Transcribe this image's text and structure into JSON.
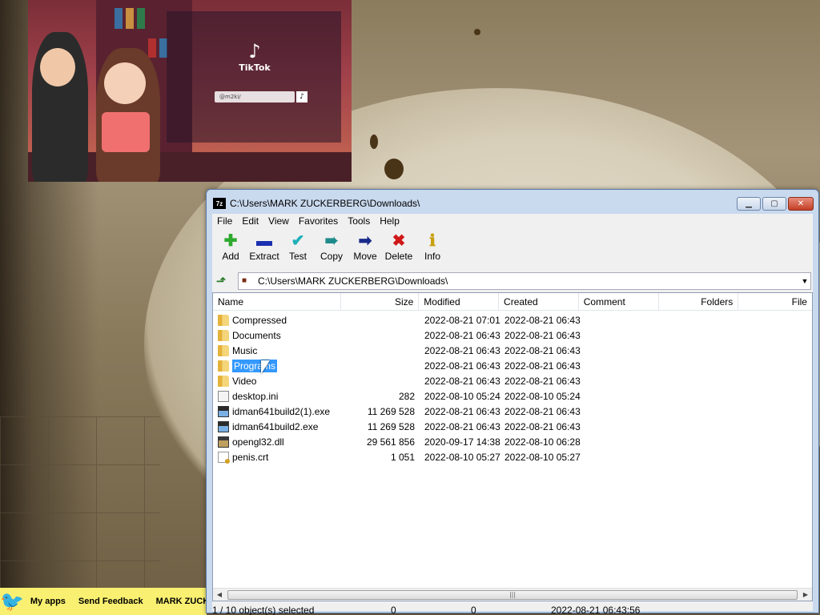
{
  "window": {
    "title": "C:\\Users\\MARK ZUCKERBERG\\Downloads\\",
    "app_icon": "7z"
  },
  "menu": [
    "File",
    "Edit",
    "View",
    "Favorites",
    "Tools",
    "Help"
  ],
  "toolbar": [
    {
      "label": "Add",
      "icon": "plus-icon",
      "color": "#2eaa2e"
    },
    {
      "label": "Extract",
      "icon": "minus-icon",
      "color": "#1a2fb0"
    },
    {
      "label": "Test",
      "icon": "check-icon",
      "color": "#1fb0b8"
    },
    {
      "label": "Copy",
      "icon": "double-arrow-icon",
      "color": "#1d8a8a"
    },
    {
      "label": "Move",
      "icon": "arrow-right-icon",
      "color": "#1a2a8a"
    },
    {
      "label": "Delete",
      "icon": "x-icon",
      "color": "#d01818"
    },
    {
      "label": "Info",
      "icon": "info-icon",
      "color": "#d0b020"
    }
  ],
  "address": "C:\\Users\\MARK ZUCKERBERG\\Downloads\\",
  "columns": [
    "Name",
    "Size",
    "Modified",
    "Created",
    "Comment",
    "Folders",
    "File"
  ],
  "files": [
    {
      "name": "Compressed",
      "size": "",
      "modified": "2022-08-21 07:01",
      "created": "2022-08-21 06:43",
      "type": "folder"
    },
    {
      "name": "Documents",
      "size": "",
      "modified": "2022-08-21 06:43",
      "created": "2022-08-21 06:43",
      "type": "folder"
    },
    {
      "name": "Music",
      "size": "",
      "modified": "2022-08-21 06:43",
      "created": "2022-08-21 06:43",
      "type": "folder"
    },
    {
      "name": "Programs",
      "size": "",
      "modified": "2022-08-21 06:43",
      "created": "2022-08-21 06:43",
      "type": "folder",
      "selected": true
    },
    {
      "name": "Video",
      "size": "",
      "modified": "2022-08-21 06:43",
      "created": "2022-08-21 06:43",
      "type": "folder"
    },
    {
      "name": "desktop.ini",
      "size": "282",
      "modified": "2022-08-10 05:24",
      "created": "2022-08-10 05:24",
      "type": "file"
    },
    {
      "name": "idman641build2(1).exe",
      "size": "11 269 528",
      "modified": "2022-08-21 06:43",
      "created": "2022-08-21 06:43",
      "type": "exe"
    },
    {
      "name": "idman641build2.exe",
      "size": "11 269 528",
      "modified": "2022-08-21 06:43",
      "created": "2022-08-21 06:43",
      "type": "exe"
    },
    {
      "name": "opengl32.dll",
      "size": "29 561 856",
      "modified": "2020-09-17 14:38",
      "created": "2022-08-10 06:28",
      "type": "dll"
    },
    {
      "name": "penis.crt",
      "size": "1 051",
      "modified": "2022-08-10 05:27",
      "created": "2022-08-10 05:27",
      "type": "crt"
    }
  ],
  "status": {
    "selection": "1 / 10 object(s) selected",
    "size1": "0",
    "size2": "0",
    "datetime": "2022-08-21 06:43:56"
  },
  "taskbar": {
    "items": [
      "My apps",
      "Send Feedback",
      "MARK ZUCK"
    ]
  },
  "video": {
    "brand": "TikTok",
    "handle": "@m2ki/"
  }
}
